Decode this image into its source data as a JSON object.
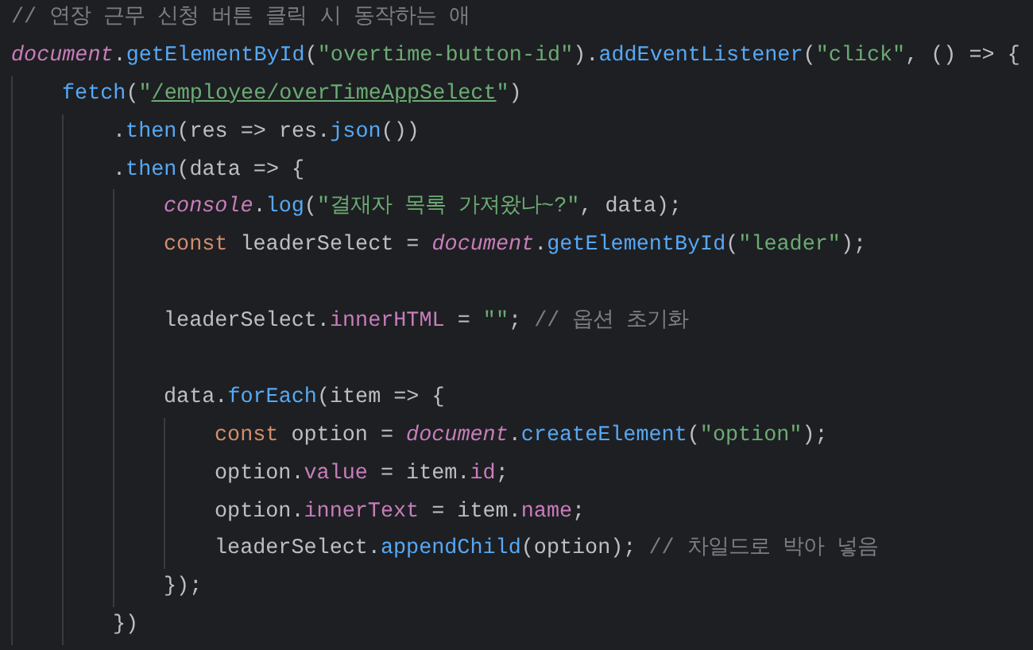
{
  "editor": {
    "lines": [
      {
        "tokens": [
          {
            "kind": "comment",
            "text": "// 연장 근무 신청 버튼 클릭 시 동작하는 애"
          }
        ]
      },
      {
        "tokens": [
          {
            "kind": "global",
            "text": "document"
          },
          {
            "kind": "plain",
            "text": "."
          },
          {
            "kind": "function",
            "text": "getElementById"
          },
          {
            "kind": "plain",
            "text": "("
          },
          {
            "kind": "string",
            "text": "\"overtime-button-id\""
          },
          {
            "kind": "plain",
            "text": ")."
          },
          {
            "kind": "function",
            "text": "addEventListener"
          },
          {
            "kind": "plain",
            "text": "("
          },
          {
            "kind": "string",
            "text": "\"click\""
          },
          {
            "kind": "plain",
            "text": ", () => {"
          }
        ],
        "children": [
          {
            "tokens": [
              {
                "kind": "function",
                "text": "fetch"
              },
              {
                "kind": "plain",
                "text": "("
              },
              {
                "kind": "string",
                "text": "\""
              },
              {
                "kind": "url",
                "text": "/employee/overTimeAppSelect"
              },
              {
                "kind": "string",
                "text": "\""
              },
              {
                "kind": "plain",
                "text": ")"
              }
            ],
            "children": [
              {
                "tokens": [
                  {
                    "kind": "plain",
                    "text": "."
                  },
                  {
                    "kind": "function",
                    "text": "then"
                  },
                  {
                    "kind": "plain",
                    "text": "(res => res."
                  },
                  {
                    "kind": "function",
                    "text": "json"
                  },
                  {
                    "kind": "plain",
                    "text": "())"
                  }
                ]
              },
              {
                "tokens": [
                  {
                    "kind": "plain",
                    "text": "."
                  },
                  {
                    "kind": "function",
                    "text": "then"
                  },
                  {
                    "kind": "plain",
                    "text": "(data => {"
                  }
                ],
                "children": [
                  {
                    "tokens": [
                      {
                        "kind": "global",
                        "text": "console"
                      },
                      {
                        "kind": "plain",
                        "text": "."
                      },
                      {
                        "kind": "function",
                        "text": "log"
                      },
                      {
                        "kind": "plain",
                        "text": "("
                      },
                      {
                        "kind": "string",
                        "text": "\"결재자 목록 가져왔나~?\""
                      },
                      {
                        "kind": "plain",
                        "text": ", data);"
                      }
                    ]
                  },
                  {
                    "tokens": [
                      {
                        "kind": "keyword",
                        "text": "const"
                      },
                      {
                        "kind": "plain",
                        "text": " leaderSelect = "
                      },
                      {
                        "kind": "global",
                        "text": "document"
                      },
                      {
                        "kind": "plain",
                        "text": "."
                      },
                      {
                        "kind": "function",
                        "text": "getElementById"
                      },
                      {
                        "kind": "plain",
                        "text": "("
                      },
                      {
                        "kind": "string",
                        "text": "\"leader\""
                      },
                      {
                        "kind": "plain",
                        "text": ");"
                      }
                    ]
                  },
                  {
                    "kind": "blank"
                  },
                  {
                    "tokens": [
                      {
                        "kind": "plain",
                        "text": "leaderSelect."
                      },
                      {
                        "kind": "property",
                        "text": "innerHTML"
                      },
                      {
                        "kind": "plain",
                        "text": " = "
                      },
                      {
                        "kind": "string",
                        "text": "\"\""
                      },
                      {
                        "kind": "plain",
                        "text": "; "
                      },
                      {
                        "kind": "comment",
                        "text": "// 옵션 초기화"
                      }
                    ]
                  },
                  {
                    "kind": "blank"
                  },
                  {
                    "tokens": [
                      {
                        "kind": "plain",
                        "text": "data."
                      },
                      {
                        "kind": "function",
                        "text": "forEach"
                      },
                      {
                        "kind": "plain",
                        "text": "(item => {"
                      }
                    ],
                    "children": [
                      {
                        "tokens": [
                          {
                            "kind": "keyword",
                            "text": "const"
                          },
                          {
                            "kind": "plain",
                            "text": " option = "
                          },
                          {
                            "kind": "global",
                            "text": "document"
                          },
                          {
                            "kind": "plain",
                            "text": "."
                          },
                          {
                            "kind": "function",
                            "text": "createElement"
                          },
                          {
                            "kind": "plain",
                            "text": "("
                          },
                          {
                            "kind": "string",
                            "text": "\"option\""
                          },
                          {
                            "kind": "plain",
                            "text": ");"
                          }
                        ]
                      },
                      {
                        "tokens": [
                          {
                            "kind": "plain",
                            "text": "option."
                          },
                          {
                            "kind": "property",
                            "text": "value"
                          },
                          {
                            "kind": "plain",
                            "text": " = item."
                          },
                          {
                            "kind": "property",
                            "text": "id"
                          },
                          {
                            "kind": "plain",
                            "text": ";"
                          }
                        ]
                      },
                      {
                        "tokens": [
                          {
                            "kind": "plain",
                            "text": "option."
                          },
                          {
                            "kind": "property",
                            "text": "innerText"
                          },
                          {
                            "kind": "plain",
                            "text": " = item."
                          },
                          {
                            "kind": "property",
                            "text": "name"
                          },
                          {
                            "kind": "plain",
                            "text": ";"
                          }
                        ]
                      },
                      {
                        "tokens": [
                          {
                            "kind": "plain",
                            "text": "leaderSelect."
                          },
                          {
                            "kind": "function",
                            "text": "appendChild"
                          },
                          {
                            "kind": "plain",
                            "text": "(option); "
                          },
                          {
                            "kind": "comment",
                            "text": "// 차일드로 박아 넣음"
                          }
                        ]
                      }
                    ]
                  },
                  {
                    "tokens": [
                      {
                        "kind": "plain",
                        "text": "});"
                      }
                    ]
                  }
                ]
              },
              {
                "tokens": [
                  {
                    "kind": "plain",
                    "text": "})"
                  }
                ]
              }
            ]
          }
        ]
      }
    ]
  }
}
